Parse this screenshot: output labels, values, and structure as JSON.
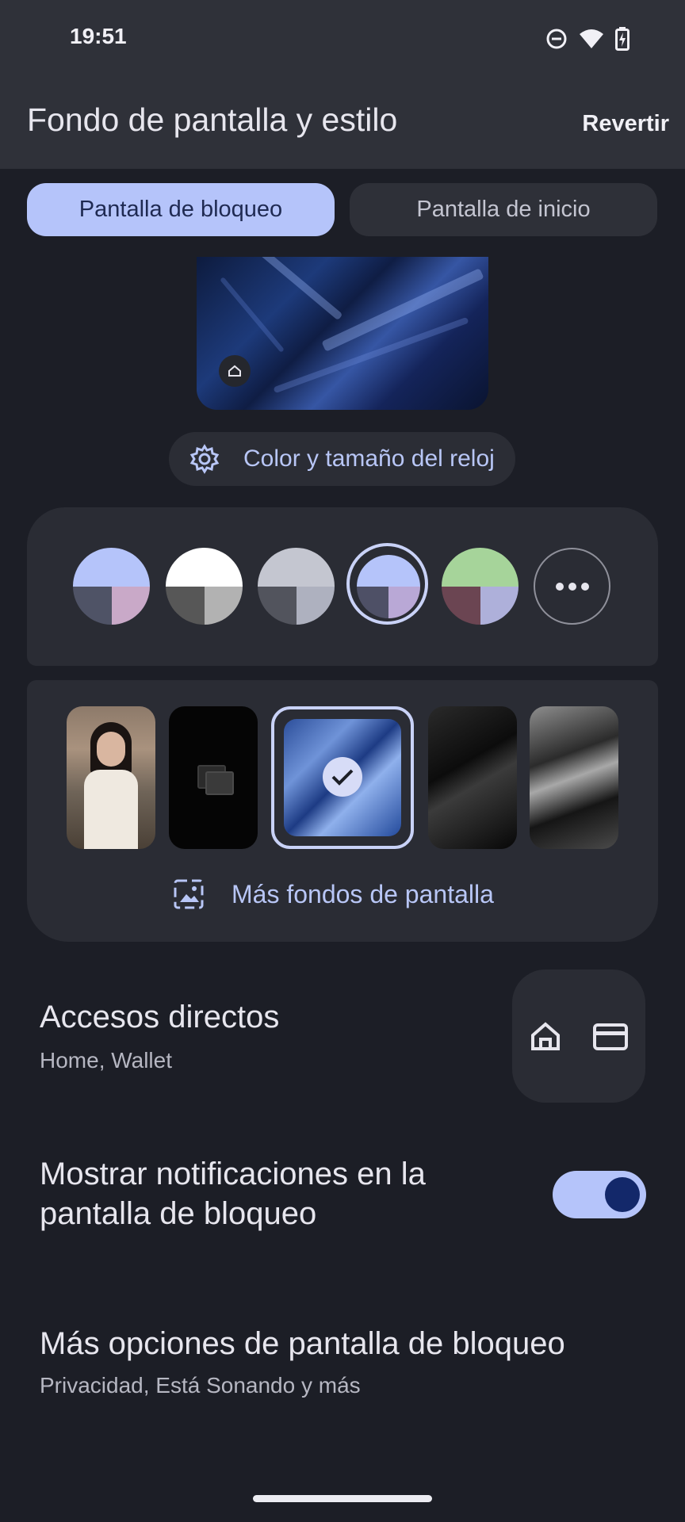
{
  "status_bar": {
    "time": "19:51",
    "icons": [
      "do-not-disturb-icon",
      "wifi-icon",
      "battery-charging-icon"
    ]
  },
  "header": {
    "title": "Fondo de pantalla y estilo",
    "action_label": "Revertir"
  },
  "tabs": [
    {
      "label": "Pantalla de bloqueo",
      "selected": true
    },
    {
      "label": "Pantalla de inicio",
      "selected": false
    }
  ],
  "preview": {
    "clock_button_label": "Color y tamaño del reloj",
    "icon": "home-icon"
  },
  "color_options": [
    {
      "top": "#b5c4fa",
      "bottom_left": "#4f5366",
      "bottom_right": "#c9a9c8",
      "selected": false
    },
    {
      "top": "#ffffff",
      "bottom_left": "#575757",
      "bottom_right": "#b2b2b2",
      "selected": false
    },
    {
      "top": "#c4c6d0",
      "bottom_left": "#52545d",
      "bottom_right": "#aeb1bf",
      "selected": false
    },
    {
      "top": "#b5c4fa",
      "bottom_left": "#4e5066",
      "bottom_right": "#b9a8d6",
      "selected": true
    },
    {
      "top": "#a6d49a",
      "bottom_left": "#6b4552",
      "bottom_right": "#aeb0da",
      "selected": false
    }
  ],
  "more_colors_icon": "more-horizontal-icon",
  "wallpapers": {
    "items": [
      "photo-portrait",
      "dark-photos-icon-wallpaper",
      "blue-crystal-wallpaper",
      "black-crystal-wallpaper",
      "grey-crystal-wallpaper"
    ],
    "selected_index": 2,
    "more_label": "Más fondos de pantalla"
  },
  "settings": {
    "shortcuts": {
      "title": "Accesos directos",
      "subtitle": "Home, Wallet",
      "icons": [
        "home-icon",
        "wallet-icon"
      ]
    },
    "notifications": {
      "title_line1": "Mostrar notificaciones en la",
      "title_line2": "pantalla de bloqueo",
      "enabled": true
    },
    "more_options": {
      "title": "Más opciones de pantalla de bloqueo",
      "subtitle": "Privacidad, Está Sonando y más"
    }
  }
}
